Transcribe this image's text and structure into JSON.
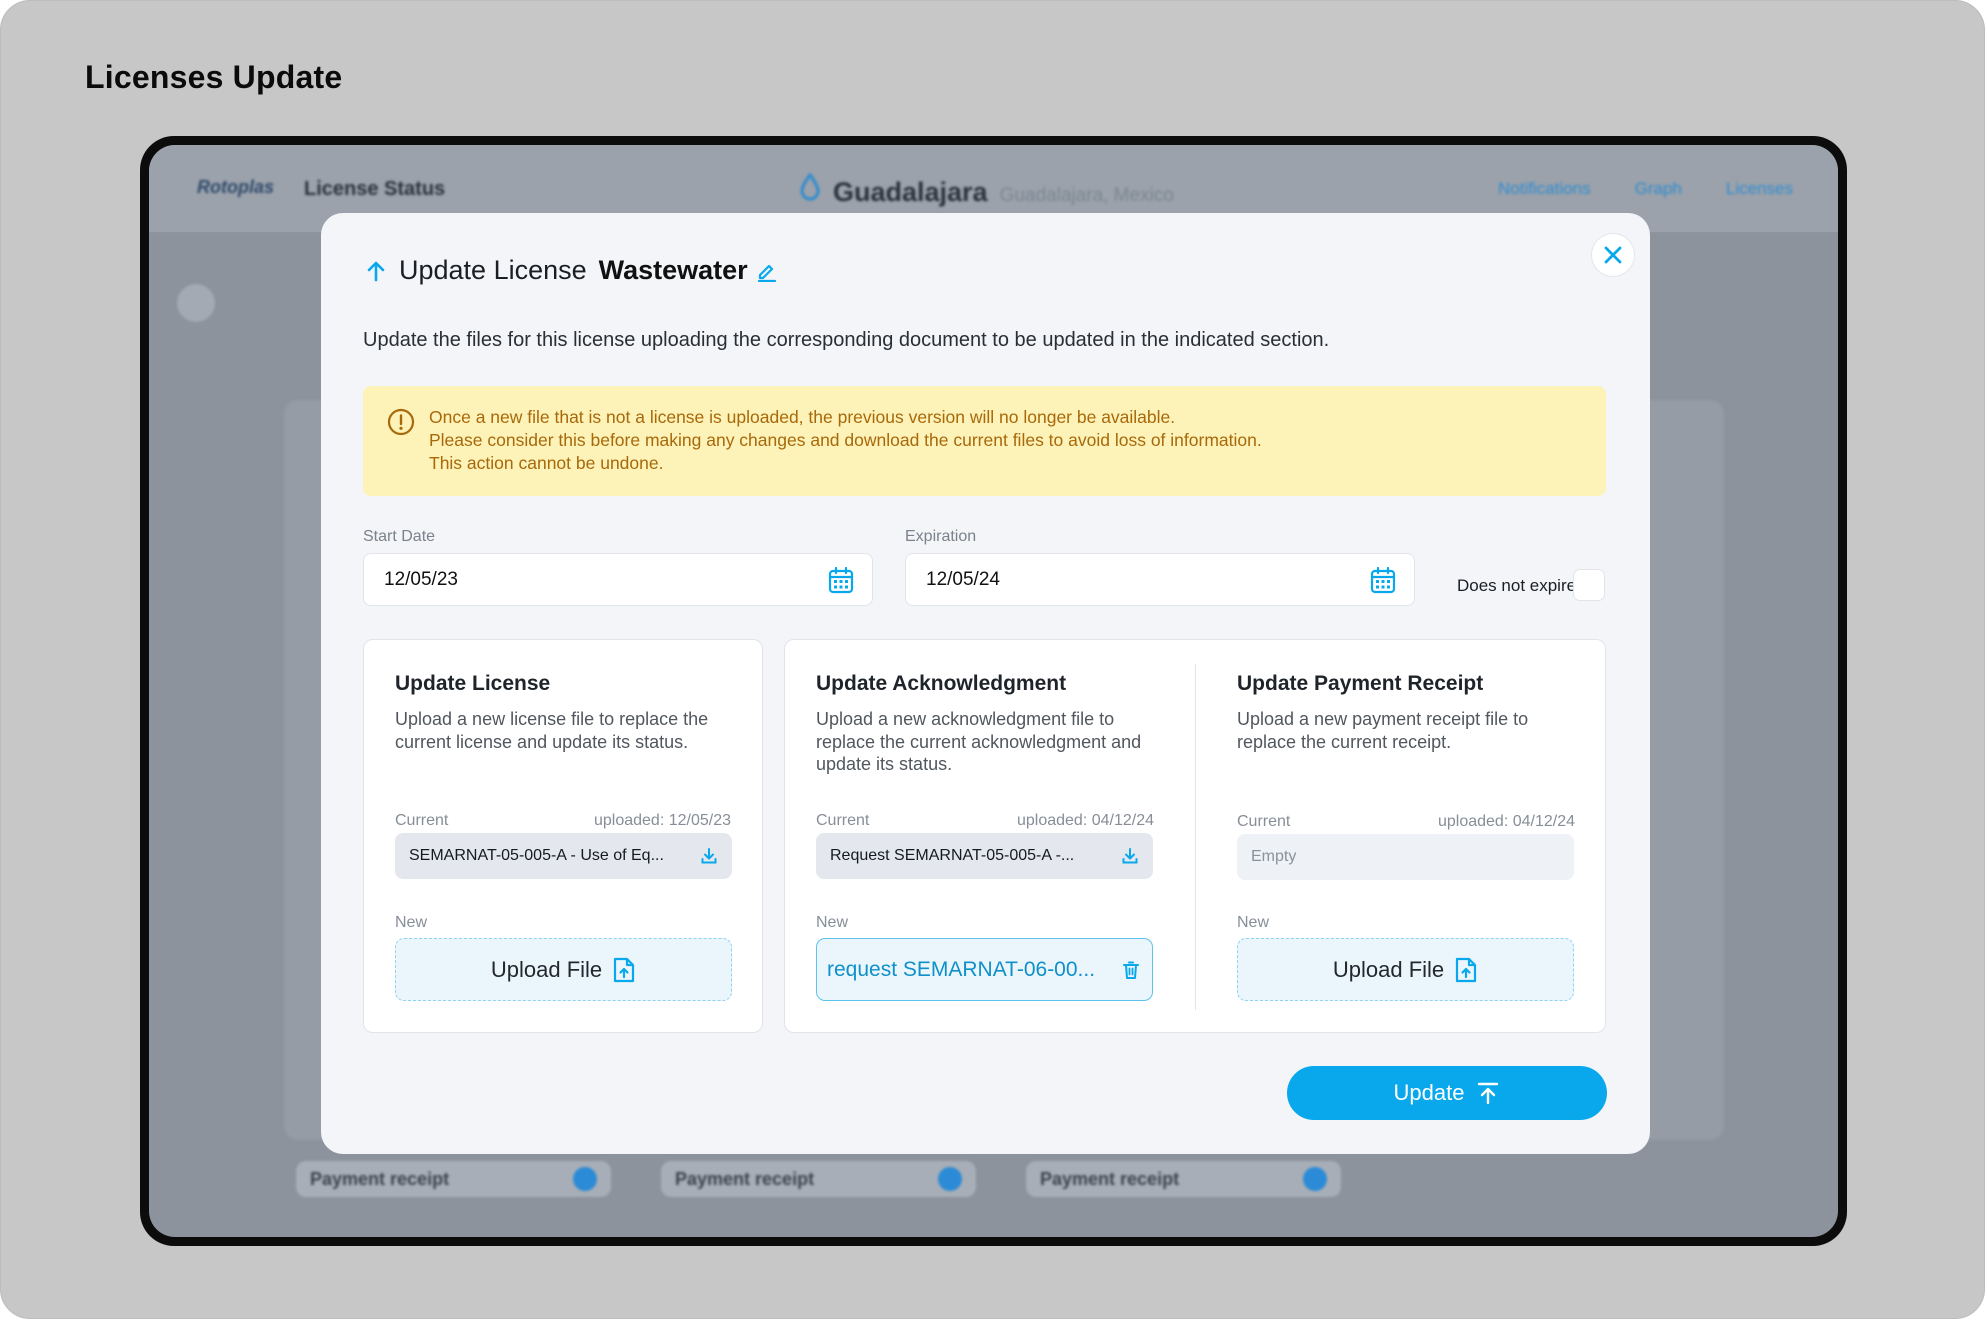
{
  "page": {
    "heading": "Licenses Update"
  },
  "background_app": {
    "logo": "Rotoplas",
    "title": "License Status",
    "city": "Guadalajara",
    "city_sub": "Guadalajara, Mexico",
    "nav_links": [
      "Notifications",
      "Graph",
      "Licenses"
    ],
    "rows": [
      "Payment receipt",
      "Payment receipt",
      "Payment receipt"
    ]
  },
  "modal": {
    "title_prefix": "Update License",
    "title_name": "Wastewater",
    "description": "Update the files for this license uploading the corresponding document to be updated in the indicated section.",
    "warning": {
      "line1": "Once a new file that is not a license is uploaded, the previous version will no longer be available.",
      "line2": "Please consider this before making any changes and download the current files to avoid loss of information.",
      "line3": "This action cannot be undone."
    },
    "start_date": {
      "label": "Start Date",
      "value": "12/05/23"
    },
    "expiration": {
      "label": "Expiration",
      "value": "12/05/24"
    },
    "does_not_expire": {
      "label": "Does not expire",
      "checked": false
    },
    "sections": {
      "license": {
        "title": "Update License",
        "description": "Upload a new license file to replace the current license and update its status.",
        "current_label": "Current",
        "uploaded": "uploaded: 12/05/23",
        "current_file": "SEMARNAT-05-005-A - Use of Eq...",
        "new_label": "New",
        "upload_label": "Upload File"
      },
      "acknowledgment": {
        "title": "Update Acknowledgment",
        "description": "Upload a new acknowledgment file to replace the current acknowledgment and update its status.",
        "current_label": "Current",
        "uploaded": "uploaded: 04/12/24",
        "current_file": "Request SEMARNAT-05-005-A -...",
        "new_label": "New",
        "new_file": "request SEMARNAT-06-00..."
      },
      "payment": {
        "title": "Update Payment Receipt",
        "description": "Upload a new payment receipt file to replace the current receipt.",
        "current_label": "Current",
        "uploaded": "uploaded: 04/12/24",
        "current_file": "Empty",
        "new_label": "New",
        "upload_label": "Upload File"
      }
    },
    "update_button": "Update"
  },
  "colors": {
    "accent": "#09a8ec",
    "warning_bg": "#fdf2b7",
    "warning_text": "#a8690b",
    "backdrop": "#8d939c"
  },
  "icons": [
    "arrow-up-icon",
    "edit-icon",
    "close-icon",
    "warning-icon",
    "calendar-icon",
    "download-icon",
    "file-upload-icon",
    "trash-icon",
    "upload-arrow-icon"
  ]
}
